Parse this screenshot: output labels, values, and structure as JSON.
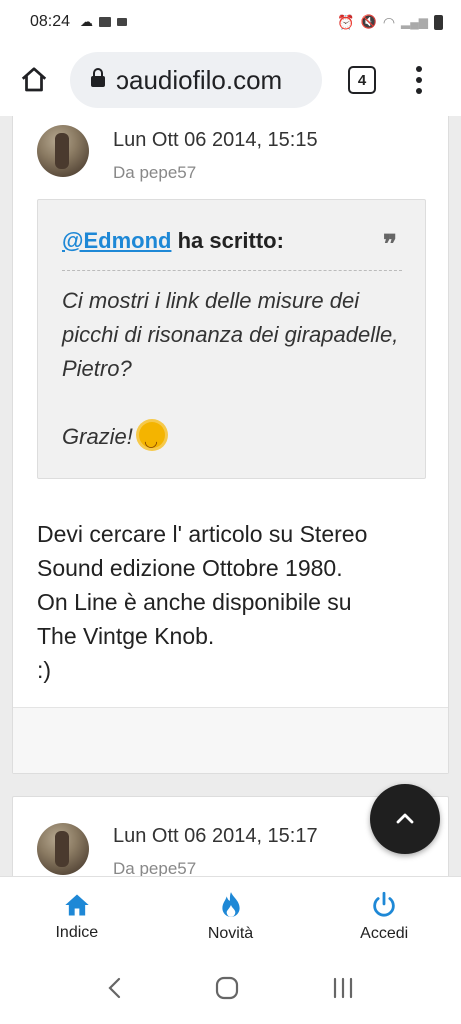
{
  "status_bar": {
    "time": "08:24"
  },
  "browser": {
    "url": "ɔaudiofilo.com",
    "tab_count": "4"
  },
  "posts": [
    {
      "date": "Lun Ott 06 2014, 15:15",
      "author": "Da pepe57",
      "quote": {
        "mention": "@Edmond",
        "wrote": " ha scritto:",
        "line1": "Ci mostri i link delle misure dei picchi di risonanza dei girapadelle, Pietro?",
        "line2": "Grazie!"
      },
      "text_lines": [
        "Devi cercare l' articolo su Stereo",
        "Sound edizione Ottobre 1980.",
        "On Line è anche disponibile su",
        "The Vintge Knob.",
        ":)"
      ]
    },
    {
      "date": "Lun Ott 06 2014, 15:17",
      "author": "Da pepe57"
    }
  ],
  "bottom_nav": [
    {
      "label": "Indice",
      "icon": "home-icon",
      "color": "#1e88d6"
    },
    {
      "label": "Novità",
      "icon": "fire-icon",
      "color": "#1e88d6"
    },
    {
      "label": "Accedi",
      "icon": "power-icon",
      "color": "#1e88d6"
    }
  ]
}
